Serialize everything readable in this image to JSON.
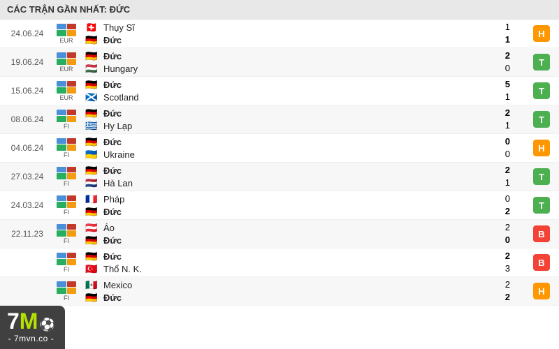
{
  "header": {
    "title": "CÁC TRẬN GẦN NHẤT: ĐỨC"
  },
  "watermark": {
    "text_7": "7",
    "text_m": "M",
    "text_ball": "⚽",
    "text_dash": "- 7mvn.co -"
  },
  "matches": [
    {
      "date": "24.06.24",
      "comp": "EUR",
      "team1": "Thụy Sĩ",
      "team1_bold": false,
      "flag1": "🇨🇭",
      "score1": "1",
      "team2": "Đức",
      "team2_bold": true,
      "flag2": "🇩🇪",
      "score2": "1",
      "result": "H",
      "result_class": "result-d"
    },
    {
      "date": "19.06.24",
      "comp": "EUR",
      "team1": "Đức",
      "team1_bold": true,
      "flag1": "🇩🇪",
      "score1": "2",
      "team2": "Hungary",
      "team2_bold": false,
      "flag2": "🇭🇺",
      "score2": "0",
      "result": "T",
      "result_class": "result-w"
    },
    {
      "date": "15.06.24",
      "comp": "EUR",
      "team1": "Đức",
      "team1_bold": true,
      "flag1": "🇩🇪",
      "score1": "5",
      "team2": "Scotland",
      "team2_bold": false,
      "flag2": "🏴󠁧󠁢󠁳󠁣󠁴󠁿",
      "score2": "1",
      "result": "T",
      "result_class": "result-w"
    },
    {
      "date": "08.06.24",
      "comp": "FI",
      "team1": "Đức",
      "team1_bold": true,
      "flag1": "🇩🇪",
      "score1": "2",
      "team2": "Hy Lạp",
      "team2_bold": false,
      "flag2": "🇬🇷",
      "score2": "1",
      "result": "T",
      "result_class": "result-w"
    },
    {
      "date": "04.06.24",
      "comp": "FI",
      "team1": "Đức",
      "team1_bold": true,
      "flag1": "🇩🇪",
      "score1": "0",
      "team2": "Ukraine",
      "team2_bold": false,
      "flag2": "🇺🇦",
      "score2": "0",
      "result": "H",
      "result_class": "result-d"
    },
    {
      "date": "27.03.24",
      "comp": "FI",
      "team1": "Đức",
      "team1_bold": true,
      "flag1": "🇩🇪",
      "score1": "2",
      "team2": "Hà Lan",
      "team2_bold": false,
      "flag2": "🇳🇱",
      "score2": "1",
      "result": "T",
      "result_class": "result-w"
    },
    {
      "date": "24.03.24",
      "comp": "FI",
      "team1": "Pháp",
      "team1_bold": false,
      "flag1": "🇫🇷",
      "score1": "0",
      "team2": "Đức",
      "team2_bold": true,
      "flag2": "🇩🇪",
      "score2": "2",
      "result": "T",
      "result_class": "result-w"
    },
    {
      "date": "22.11.23",
      "comp": "FI",
      "team1": "Áo",
      "team1_bold": false,
      "flag1": "🇦🇹",
      "score1": "2",
      "team2": "Đức",
      "team2_bold": true,
      "flag2": "🇩🇪",
      "score2": "0",
      "result": "B",
      "result_class": "result-l"
    },
    {
      "date": "",
      "comp": "FI",
      "team1": "Đức",
      "team1_bold": true,
      "flag1": "🇩🇪",
      "score1": "2",
      "team2": "Thổ N. K.",
      "team2_bold": false,
      "flag2": "🇹🇷",
      "score2": "3",
      "result": "B",
      "result_class": "result-l"
    },
    {
      "date": "",
      "comp": "FI",
      "team1": "Mexico",
      "team1_bold": false,
      "flag1": "🇲🇽",
      "score1": "2",
      "team2": "Đức",
      "team2_bold": true,
      "flag2": "🇩🇪",
      "score2": "2",
      "result": "H",
      "result_class": "result-d"
    }
  ]
}
